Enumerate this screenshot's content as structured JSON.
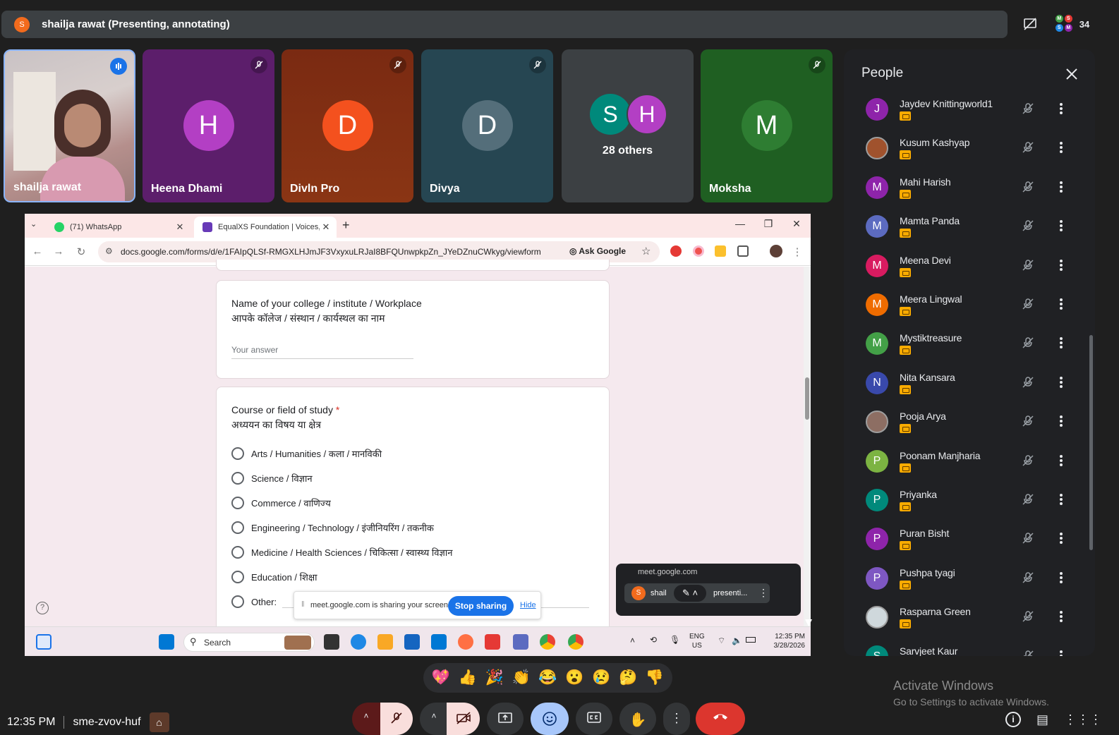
{
  "banner": {
    "presenter_initial": "S",
    "text": "shailja rawat (Presenting, annotating)",
    "people_count": "34"
  },
  "tiles": [
    {
      "name": "shailja rawat",
      "initial": "",
      "color": "#b6a5a8",
      "video": true
    },
    {
      "name": "Heena Dhami",
      "initial": "H",
      "color": "#b33fc4",
      "bg": "#5c1e6b"
    },
    {
      "name": "Divln Pro",
      "initial": "D",
      "color": "#f4511e",
      "bg": "#8a2f12"
    },
    {
      "name": "Divya",
      "initial": "D",
      "color": "#546e7a",
      "bg": "#264652"
    },
    {
      "name": "28 others",
      "initials": [
        "S",
        "H"
      ],
      "colors": [
        "#00897b",
        "#b33fc4"
      ]
    },
    {
      "name": "Moksha",
      "initial": "M",
      "color": "#2e7d32",
      "bg": "#1f5f22"
    }
  ],
  "people": {
    "title": "People",
    "list": [
      {
        "name": "Jaydev Knittingworld1",
        "initial": "J",
        "color": "#8e24aa"
      },
      {
        "name": "Kusum Kashyap",
        "initial": "",
        "color": "#a0522d",
        "photo": true
      },
      {
        "name": "Mahi Harish",
        "initial": "M",
        "color": "#8e24aa"
      },
      {
        "name": "Mamta Panda",
        "initial": "M",
        "color": "#5c6bc0"
      },
      {
        "name": "Meena Devi",
        "initial": "M",
        "color": "#d81b60"
      },
      {
        "name": "Meera Lingwal",
        "initial": "M",
        "color": "#ef6c00"
      },
      {
        "name": "Mystiktreasure",
        "initial": "M",
        "color": "#43a047"
      },
      {
        "name": "Nita Kansara",
        "initial": "N",
        "color": "#3949ab"
      },
      {
        "name": "Pooja Arya",
        "initial": "",
        "color": "#8d6e63",
        "photo": true
      },
      {
        "name": "Poonam Manjharia",
        "initial": "P",
        "color": "#7cb342"
      },
      {
        "name": "Priyanka",
        "initial": "P",
        "color": "#00897b"
      },
      {
        "name": "Puran Bisht",
        "initial": "P",
        "color": "#8e24aa"
      },
      {
        "name": "Pushpa tyagi",
        "initial": "P",
        "color": "#7e57c2"
      },
      {
        "name": "Rasparna Green",
        "initial": "",
        "color": "#cfd8dc",
        "photo": true
      },
      {
        "name": "Sarvjeet Kaur",
        "initial": "S",
        "color": "#00897b"
      }
    ]
  },
  "browser": {
    "tabs": [
      {
        "label": "(71) WhatsApp",
        "color": "#25d366"
      },
      {
        "label": "EqualXS Foundation | Voices, Sk",
        "color": "#673ab7"
      }
    ],
    "url": "docs.google.com/forms/d/e/1FAIpQLSf-RMGXLHJmJF3VxyxuLRJaI8BFQUnwpkpZn_JYeDZnuCWkyg/viewform",
    "ask_google": "Ask Google"
  },
  "form": {
    "q1_en": "Name of your college / institute / Workplace",
    "q1_hi": "आपके कॉलेज / संस्थान / कार्यस्थल का नाम",
    "q1_placeholder": "Your answer",
    "q2_en": "Course or field of study",
    "q2_required": "*",
    "q2_hi": "अध्ययन का विषय या क्षेत्र",
    "options": [
      "Arts / Humanities / कला / मानविकी",
      "Science / विज्ञान",
      "Commerce / वाणिज्य",
      "Engineering / Technology / इंजीनियरिंग / तकनीक",
      "Medicine / Health Sciences / चिकित्सा / स्वास्थ्य विज्ञान",
      "Education / शिक्षा",
      "Other:"
    ]
  },
  "sharebar": {
    "text": "meet.google.com is sharing your screen.",
    "stop": "Stop sharing",
    "hide": "Hide"
  },
  "minimeet": {
    "host": "meet.google.com",
    "initial": "S",
    "label_a": "shail",
    "label_b": "presenti..."
  },
  "taskbar": {
    "search": "Search",
    "lang1": "ENG",
    "lang2": "US",
    "time": "12:35 PM",
    "date": "3/28/2026"
  },
  "reactions": [
    "💖",
    "👍",
    "🎉",
    "👏",
    "😂",
    "😮",
    "😢",
    "🤔",
    "👎"
  ],
  "bottom": {
    "time": "12:35 PM",
    "meeting_code": "sme-zvov-huf"
  },
  "watermark": {
    "line1": "Activate Windows",
    "line2": "Go to Settings to activate Windows."
  }
}
